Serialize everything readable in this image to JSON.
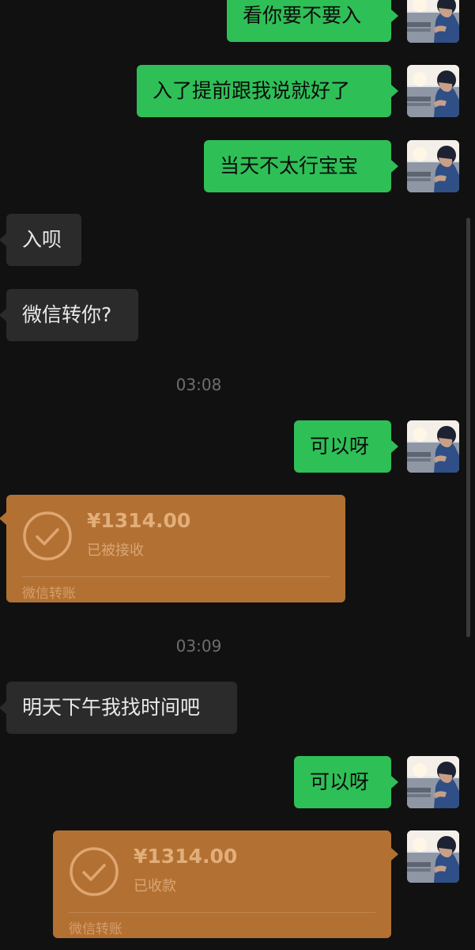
{
  "messages": [
    {
      "text": "看你要不要入"
    },
    {
      "text": "入了提前跟我说就好了"
    },
    {
      "text": "当天不太行宝宝"
    },
    {
      "text": "入呗"
    },
    {
      "text": "微信转你?"
    },
    {
      "text": "可以呀"
    },
    {
      "text": "明天下午我找时间吧"
    },
    {
      "text": "可以呀"
    }
  ],
  "timestamps": [
    "03:08",
    "03:09"
  ],
  "transfers": [
    {
      "amount": "¥1314.00",
      "status": "已被接收",
      "label": "微信转账"
    },
    {
      "amount": "¥1314.00",
      "status": "已收款",
      "label": "微信转账"
    }
  ],
  "colors": {
    "background": "#111111",
    "outgoing_bubble": "#2fbf57",
    "incoming_bubble": "#2b2b2b",
    "transfer_card": "#b27132"
  }
}
